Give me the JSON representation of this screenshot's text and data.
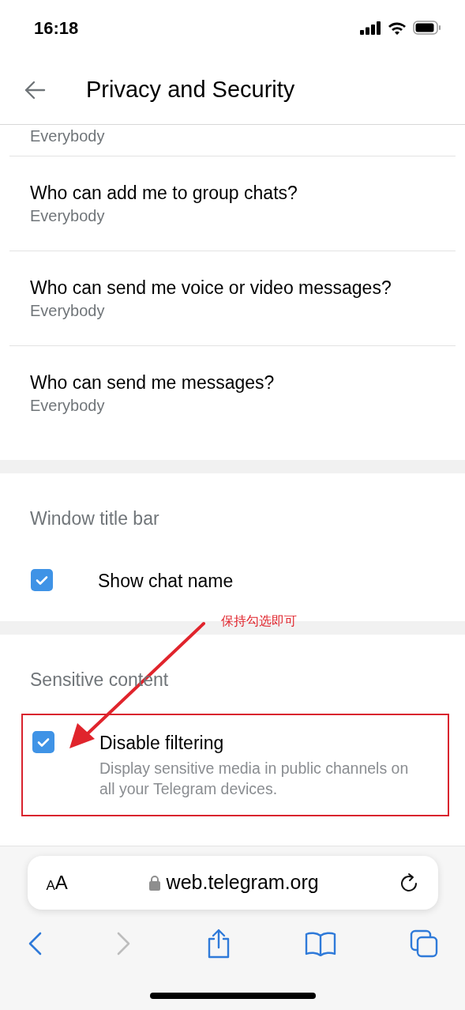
{
  "status_bar": {
    "time": "16:18"
  },
  "header": {
    "title": "Privacy and Security"
  },
  "privacy_list": [
    {
      "subtitle": "Everybody"
    },
    {
      "title": "Who can add me to group chats?",
      "subtitle": "Everybody"
    },
    {
      "title": "Who can send me voice or video messages?",
      "subtitle": "Everybody"
    },
    {
      "title": "Who can send me messages?",
      "subtitle": "Everybody"
    }
  ],
  "sections": [
    {
      "heading": "Window title bar",
      "options": [
        {
          "label": "Show chat name",
          "checked": true
        }
      ]
    },
    {
      "heading": "Sensitive content",
      "options": [
        {
          "label": "Disable filtering",
          "description": "Display sensitive media in public channels on all your Telegram devices.",
          "checked": true,
          "highlighted": true
        }
      ]
    }
  ],
  "annotation": {
    "note": "保持勾选即可"
  },
  "browser": {
    "text_size": {
      "small": "A",
      "large": "A"
    },
    "url": "web.telegram.org",
    "forward_disabled": true
  }
}
